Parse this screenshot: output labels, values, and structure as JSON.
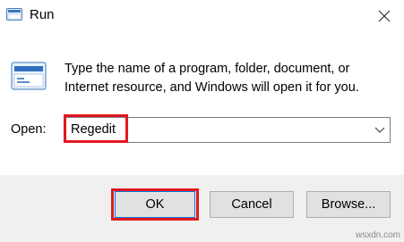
{
  "window": {
    "title": "Run",
    "icon": "run-icon",
    "close_icon": "close-icon"
  },
  "main": {
    "icon": "run-app-icon",
    "description": "Type the name of a program, folder, document, or Internet resource, and Windows will open it for you.",
    "open_label": "Open:",
    "open_value": "Regedit",
    "dropdown_icon": "chevron-down-icon"
  },
  "buttons": {
    "ok": "OK",
    "cancel": "Cancel",
    "browse": "Browse..."
  },
  "highlight_color": "#e3171f",
  "watermark": "wsxdn.com"
}
